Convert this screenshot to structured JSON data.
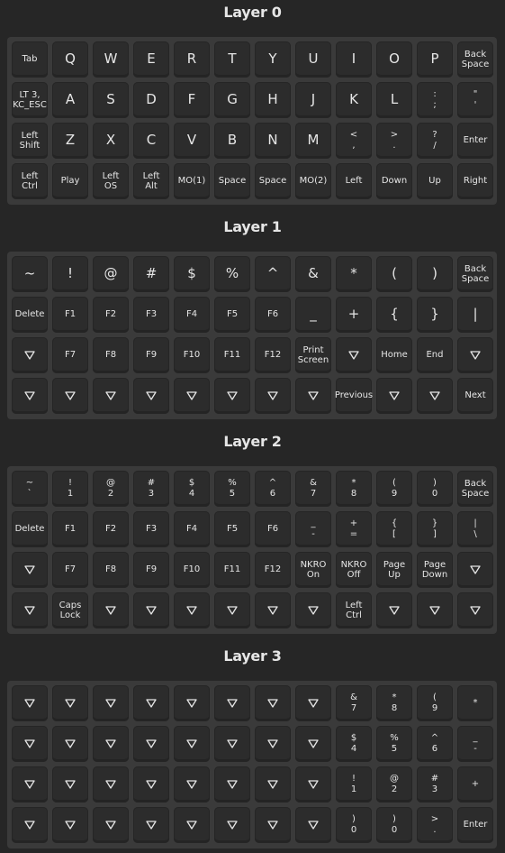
{
  "layers": [
    {
      "title": "Layer 0",
      "rows": [
        [
          {
            "t": "Tab",
            "s": "small"
          },
          {
            "t": "Q",
            "s": "big"
          },
          {
            "t": "W",
            "s": "big"
          },
          {
            "t": "E",
            "s": "big"
          },
          {
            "t": "R",
            "s": "big"
          },
          {
            "t": "T",
            "s": "big"
          },
          {
            "t": "Y",
            "s": "big"
          },
          {
            "t": "U",
            "s": "big"
          },
          {
            "t": "I",
            "s": "big"
          },
          {
            "t": "O",
            "s": "big"
          },
          {
            "t": "P",
            "s": "big"
          },
          {
            "t": "Back\nSpace",
            "s": "two"
          }
        ],
        [
          {
            "t": "LT 3,\nKC_ESC",
            "s": "two"
          },
          {
            "t": "A",
            "s": "big"
          },
          {
            "t": "S",
            "s": "big"
          },
          {
            "t": "D",
            "s": "big"
          },
          {
            "t": "F",
            "s": "big"
          },
          {
            "t": "G",
            "s": "big"
          },
          {
            "t": "H",
            "s": "big"
          },
          {
            "t": "J",
            "s": "big"
          },
          {
            "t": "K",
            "s": "big"
          },
          {
            "t": "L",
            "s": "big"
          },
          {
            "top": ":",
            "bot": ";",
            "s": "pair"
          },
          {
            "top": "\"",
            "bot": "'",
            "s": "pair"
          }
        ],
        [
          {
            "t": "Left\nShift",
            "s": "two"
          },
          {
            "t": "Z",
            "s": "big"
          },
          {
            "t": "X",
            "s": "big"
          },
          {
            "t": "C",
            "s": "big"
          },
          {
            "t": "V",
            "s": "big"
          },
          {
            "t": "B",
            "s": "big"
          },
          {
            "t": "N",
            "s": "big"
          },
          {
            "t": "M",
            "s": "big"
          },
          {
            "top": "<",
            "bot": ",",
            "s": "pair"
          },
          {
            "top": ">",
            "bot": ".",
            "s": "pair"
          },
          {
            "top": "?",
            "bot": "/",
            "s": "pair"
          },
          {
            "t": "Enter",
            "s": "small"
          }
        ],
        [
          {
            "t": "Left\nCtrl",
            "s": "two"
          },
          {
            "t": "Play",
            "s": "small"
          },
          {
            "t": "Left\nOS",
            "s": "two"
          },
          {
            "t": "Left\nAlt",
            "s": "two"
          },
          {
            "t": "MO(1)",
            "s": "small"
          },
          {
            "t": "Space",
            "s": "small"
          },
          {
            "t": "Space",
            "s": "small"
          },
          {
            "t": "MO(2)",
            "s": "small"
          },
          {
            "t": "Left",
            "s": "small"
          },
          {
            "t": "Down",
            "s": "small"
          },
          {
            "t": "Up",
            "s": "small"
          },
          {
            "t": "Right",
            "s": "small"
          }
        ]
      ]
    },
    {
      "title": "Layer 1",
      "rows": [
        [
          {
            "t": "~",
            "s": "big"
          },
          {
            "t": "!",
            "s": "big"
          },
          {
            "t": "@",
            "s": "big"
          },
          {
            "t": "#",
            "s": "big"
          },
          {
            "t": "$",
            "s": "big"
          },
          {
            "t": "%",
            "s": "big"
          },
          {
            "t": "^",
            "s": "big"
          },
          {
            "t": "&",
            "s": "big"
          },
          {
            "t": "*",
            "s": "big"
          },
          {
            "t": "(",
            "s": "big"
          },
          {
            "t": ")",
            "s": "big"
          },
          {
            "t": "Back\nSpace",
            "s": "two"
          }
        ],
        [
          {
            "t": "Delete",
            "s": "small"
          },
          {
            "t": "F1",
            "s": "small"
          },
          {
            "t": "F2",
            "s": "small"
          },
          {
            "t": "F3",
            "s": "small"
          },
          {
            "t": "F4",
            "s": "small"
          },
          {
            "t": "F5",
            "s": "small"
          },
          {
            "t": "F6",
            "s": "small"
          },
          {
            "t": "_",
            "s": "big"
          },
          {
            "t": "+",
            "s": "big"
          },
          {
            "t": "{",
            "s": "big"
          },
          {
            "t": "}",
            "s": "big"
          },
          {
            "t": "|",
            "s": "big"
          }
        ],
        [
          {
            "tri": true
          },
          {
            "t": "F7",
            "s": "small"
          },
          {
            "t": "F8",
            "s": "small"
          },
          {
            "t": "F9",
            "s": "small"
          },
          {
            "t": "F10",
            "s": "small"
          },
          {
            "t": "F11",
            "s": "small"
          },
          {
            "t": "F12",
            "s": "small"
          },
          {
            "t": "Print\nScreen",
            "s": "two"
          },
          {
            "tri": true
          },
          {
            "t": "Home",
            "s": "small"
          },
          {
            "t": "End",
            "s": "small"
          },
          {
            "tri": true
          }
        ],
        [
          {
            "tri": true
          },
          {
            "tri": true
          },
          {
            "tri": true
          },
          {
            "tri": true
          },
          {
            "tri": true
          },
          {
            "tri": true
          },
          {
            "tri": true
          },
          {
            "tri": true
          },
          {
            "t": "Previous",
            "s": "small"
          },
          {
            "tri": true
          },
          {
            "tri": true
          },
          {
            "t": "Next",
            "s": "small"
          }
        ]
      ]
    },
    {
      "title": "Layer 2",
      "rows": [
        [
          {
            "top": "~",
            "bot": "`",
            "s": "pair"
          },
          {
            "top": "!",
            "bot": "1",
            "s": "pair"
          },
          {
            "top": "@",
            "bot": "2",
            "s": "pair"
          },
          {
            "top": "#",
            "bot": "3",
            "s": "pair"
          },
          {
            "top": "$",
            "bot": "4",
            "s": "pair"
          },
          {
            "top": "%",
            "bot": "5",
            "s": "pair"
          },
          {
            "top": "^",
            "bot": "6",
            "s": "pair"
          },
          {
            "top": "&",
            "bot": "7",
            "s": "pair"
          },
          {
            "top": "*",
            "bot": "8",
            "s": "pair"
          },
          {
            "top": "(",
            "bot": "9",
            "s": "pair"
          },
          {
            "top": ")",
            "bot": "0",
            "s": "pair"
          },
          {
            "t": "Back\nSpace",
            "s": "two"
          }
        ],
        [
          {
            "t": "Delete",
            "s": "small"
          },
          {
            "t": "F1",
            "s": "small"
          },
          {
            "t": "F2",
            "s": "small"
          },
          {
            "t": "F3",
            "s": "small"
          },
          {
            "t": "F4",
            "s": "small"
          },
          {
            "t": "F5",
            "s": "small"
          },
          {
            "t": "F6",
            "s": "small"
          },
          {
            "top": "_",
            "bot": "-",
            "s": "pair"
          },
          {
            "top": "+",
            "bot": "=",
            "s": "pair"
          },
          {
            "top": "{",
            "bot": "[",
            "s": "pair"
          },
          {
            "top": "}",
            "bot": "]",
            "s": "pair"
          },
          {
            "top": "|",
            "bot": "\\",
            "s": "pair"
          }
        ],
        [
          {
            "tri": true
          },
          {
            "t": "F7",
            "s": "small"
          },
          {
            "t": "F8",
            "s": "small"
          },
          {
            "t": "F9",
            "s": "small"
          },
          {
            "t": "F10",
            "s": "small"
          },
          {
            "t": "F11",
            "s": "small"
          },
          {
            "t": "F12",
            "s": "small"
          },
          {
            "t": "NKRO\nOn",
            "s": "two"
          },
          {
            "t": "NKRO\nOff",
            "s": "two"
          },
          {
            "t": "Page\nUp",
            "s": "two"
          },
          {
            "t": "Page\nDown",
            "s": "two"
          },
          {
            "tri": true
          }
        ],
        [
          {
            "tri": true
          },
          {
            "t": "Caps\nLock",
            "s": "two"
          },
          {
            "tri": true
          },
          {
            "tri": true
          },
          {
            "tri": true
          },
          {
            "tri": true
          },
          {
            "tri": true
          },
          {
            "tri": true
          },
          {
            "t": "Left\nCtrl",
            "s": "two"
          },
          {
            "tri": true
          },
          {
            "tri": true
          },
          {
            "tri": true
          }
        ]
      ]
    },
    {
      "title": "Layer 3",
      "rows": [
        [
          {
            "tri": true
          },
          {
            "tri": true
          },
          {
            "tri": true
          },
          {
            "tri": true
          },
          {
            "tri": true
          },
          {
            "tri": true
          },
          {
            "tri": true
          },
          {
            "tri": true
          },
          {
            "top": "&",
            "bot": "7",
            "s": "pair"
          },
          {
            "top": "*",
            "bot": "8",
            "s": "pair"
          },
          {
            "top": "(",
            "bot": "9",
            "s": "pair"
          },
          {
            "t": "*",
            "s": "small"
          }
        ],
        [
          {
            "tri": true
          },
          {
            "tri": true
          },
          {
            "tri": true
          },
          {
            "tri": true
          },
          {
            "tri": true
          },
          {
            "tri": true
          },
          {
            "tri": true
          },
          {
            "tri": true
          },
          {
            "top": "$",
            "bot": "4",
            "s": "pair"
          },
          {
            "top": "%",
            "bot": "5",
            "s": "pair"
          },
          {
            "top": "^",
            "bot": "6",
            "s": "pair"
          },
          {
            "top": "_",
            "bot": "-",
            "s": "pair"
          }
        ],
        [
          {
            "tri": true
          },
          {
            "tri": true
          },
          {
            "tri": true
          },
          {
            "tri": true
          },
          {
            "tri": true
          },
          {
            "tri": true
          },
          {
            "tri": true
          },
          {
            "tri": true
          },
          {
            "top": "!",
            "bot": "1",
            "s": "pair"
          },
          {
            "top": "@",
            "bot": "2",
            "s": "pair"
          },
          {
            "top": "#",
            "bot": "3",
            "s": "pair"
          },
          {
            "t": "+",
            "s": "small"
          }
        ],
        [
          {
            "tri": true
          },
          {
            "tri": true
          },
          {
            "tri": true
          },
          {
            "tri": true
          },
          {
            "tri": true
          },
          {
            "tri": true
          },
          {
            "tri": true
          },
          {
            "tri": true
          },
          {
            "top": ")",
            "bot": "0",
            "s": "pair"
          },
          {
            "top": ")",
            "bot": "0",
            "s": "pair"
          },
          {
            "top": ">",
            "bot": ".",
            "s": "pair"
          },
          {
            "t": "Enter",
            "s": "small"
          }
        ]
      ]
    }
  ]
}
